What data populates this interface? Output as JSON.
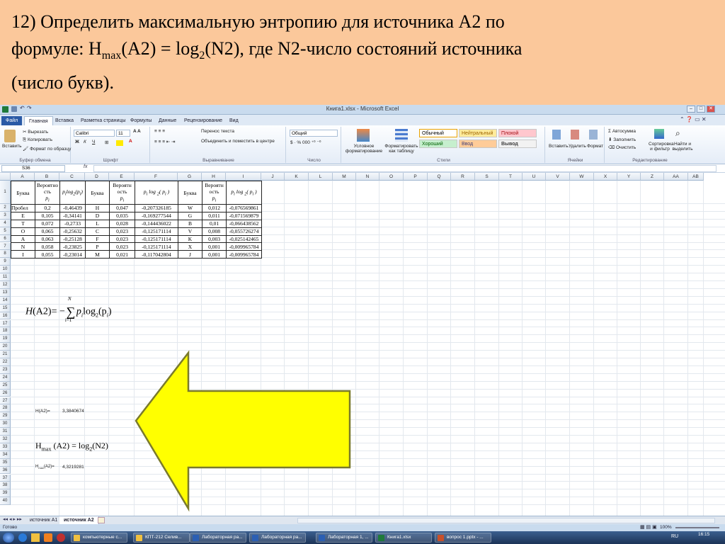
{
  "slide": {
    "line1": "12) Определить максимальную энтропию для источника А2 по",
    "line2_pre": "формуле: H",
    "line2_sub1": "max",
    "line2_mid": "(A2) = log",
    "line2_sub2": "2",
    "line2_post": "(N2), где N2-число состояний источника",
    "line3": "(число букв)."
  },
  "excel": {
    "window_title": "Книга1.xlsx - Microsoft Excel",
    "tabs": [
      "Файл",
      "Главная",
      "Вставка",
      "Разметка страницы",
      "Формулы",
      "Данные",
      "Рецензирование",
      "Вид"
    ],
    "ribbon": {
      "paste": "Вставить",
      "cut": "Вырезать",
      "copy": "Копировать",
      "format_painter": "Формат по образцу",
      "clipboard_group": "Буфер обмена",
      "font_name": "Calibri",
      "font_size": "11",
      "font_group": "Шрифт",
      "wrap_text": "Перенос текста",
      "merge_center": "Объединить и поместить в центре",
      "align_group": "Выравнивание",
      "number_format": "Общий",
      "number_group": "Число",
      "cond_format": "Условное форматирование",
      "format_table": "Форматировать как таблицу",
      "styles": [
        "Обычный",
        "Нейтральный",
        "Плохой",
        "Хороший",
        "Ввод",
        "Вывод"
      ],
      "styles_group": "Стили",
      "insert": "Вставить",
      "delete": "Удалить",
      "format": "Формат",
      "cells_group": "Ячейки",
      "autosum": "Автосумма",
      "fill": "Заполнить",
      "clear": "Очистить",
      "sort_filter": "Сортировка и фильтр",
      "find_select": "Найти и выделить",
      "editing_group": "Редактирование"
    },
    "name_box": "S36",
    "fx": "fx",
    "columns": [
      "A",
      "B",
      "C",
      "D",
      "E",
      "F",
      "G",
      "H",
      "I",
      "J",
      "K",
      "L",
      "M",
      "N",
      "O",
      "P",
      "Q",
      "R",
      "S",
      "T",
      "U",
      "V",
      "W",
      "X",
      "Y",
      "Z",
      "AA",
      "AB"
    ],
    "table": {
      "headers": [
        "Буква",
        "Вероятность p_i",
        "p_i log2(p_i)",
        "Буква",
        "Вероятность p_i",
        "p_i log2(p_i)",
        "Буква",
        "Вероятность p_i",
        "p_i log2(p_i)"
      ],
      "header_labels": {
        "letter": "Буква",
        "prob_top": "Вероятно",
        "prob_mid": "сть",
        "prob_top2": "Вероятн",
        "prob_mid2": "ость",
        "prob_top3": "Вероятн",
        "prob_mid3": "ость",
        "pi": "p",
        "i": "i",
        "log": "log",
        "two": "2"
      },
      "rows": [
        [
          "Пробел",
          "0,2",
          "-0,46439",
          "Н",
          "0,047",
          "-0,207326185",
          "W",
          "0,012",
          "-0,076569861"
        ],
        [
          "E",
          "0,105",
          "-0,34141",
          "D",
          "0,035",
          "-0,169277544",
          "G",
          "0,011",
          "-0,071569879"
        ],
        [
          "T",
          "0,072",
          "-0,2733",
          "L",
          "0,028",
          "-0,144436022",
          "B",
          "0,01",
          "-0,066438562"
        ],
        [
          "O",
          "0,065",
          "-0,25632",
          "C",
          "0,023",
          "-0,125171114",
          "V",
          "0,008",
          "-0,055726274"
        ],
        [
          "A",
          "0,063",
          "-0,25128",
          "F",
          "0,023",
          "-0,125171114",
          "K",
          "0,003",
          "-0,025142465"
        ],
        [
          "N",
          "0,058",
          "-0,23825",
          "P",
          "0,023",
          "-0,125171114",
          "X",
          "0,001",
          "-0,009965784"
        ],
        [
          "I",
          "0,055",
          "-0,23014",
          "M",
          "0,021",
          "-0,117042804",
          "J",
          "0,001",
          "-0,009965784"
        ]
      ]
    },
    "entropy_formula": {
      "h": "H",
      "arg": "(A2)",
      "eq": "= −",
      "sum": "∑",
      "top": "N",
      "bottom": "i=1",
      "body_p": "p",
      "body_i": "i",
      "body_log": "log",
      "body_2": "2",
      "body_arg": "(p",
      "body_arg_i": "i",
      "close": ")"
    },
    "h_label": "H(A2)=",
    "h_value": "3,3840674",
    "hmax_formula": {
      "h": "H",
      "sub": "max",
      "mid": " (A2) = log",
      "sub2": "2",
      "post": "(N2)"
    },
    "hmax_label_h": "H",
    "hmax_label_sub": "max",
    "hmax_label_post": "(A2)=",
    "hmax_value": "4,3219281",
    "sheet_tabs": [
      "источник А1",
      "источник А2"
    ],
    "status": "Готово",
    "zoom": "100%",
    "taskbar": [
      "компьютерные с...",
      "КПТ-212 Селив...",
      "Лабораторная ра...",
      "Лабораторная ра...",
      "Лабораторная 1, ...",
      "Книга1.xlsx",
      "вопрос 1.pptx - ..."
    ],
    "tray_lang": "RU",
    "tray_time": "16:15",
    "colors": {
      "arrow": "#ffff00",
      "arrow_stroke": "#7a7a2c",
      "banner": "#fbc89b"
    }
  }
}
